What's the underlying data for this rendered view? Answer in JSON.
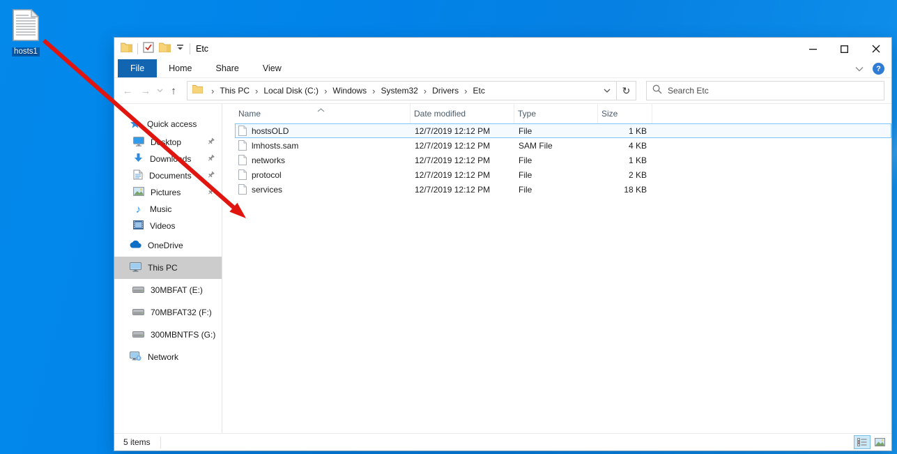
{
  "desktop": {
    "shortcut_label": "hosts1"
  },
  "titlebar": {
    "title": "Etc"
  },
  "ribbon": {
    "tabs": {
      "file": "File",
      "home": "Home",
      "share": "Share",
      "view": "View"
    },
    "help_glyph": "?"
  },
  "nav": {
    "glyphs": {
      "back": "←",
      "forward": "→",
      "up": "↑",
      "refresh": "↻",
      "crumb_sep": "›"
    },
    "breadcrumb": [
      "This PC",
      "Local Disk (C:)",
      "Windows",
      "System32",
      "Drivers",
      "Etc"
    ],
    "search_placeholder": "Search Etc"
  },
  "sidebar": {
    "items": [
      {
        "label": "Quick access"
      },
      {
        "label": "Desktop",
        "pinned": true
      },
      {
        "label": "Downloads",
        "pinned": true
      },
      {
        "label": "Documents",
        "pinned": true
      },
      {
        "label": "Pictures",
        "pinned": true
      },
      {
        "label": "Music"
      },
      {
        "label": "Videos"
      },
      {
        "label": "OneDrive"
      },
      {
        "label": "This PC",
        "selected": true
      },
      {
        "label": "30MBFAT (E:)"
      },
      {
        "label": "70MBFAT32 (F:)"
      },
      {
        "label": "300MBNTFS (G:)"
      },
      {
        "label": "Network"
      }
    ],
    "music_glyph": "♪"
  },
  "filelist": {
    "columns": [
      "Name",
      "Date modified",
      "Type",
      "Size"
    ],
    "rows": [
      {
        "name": "hostsOLD",
        "date": "12/7/2019 12:12 PM",
        "type": "File",
        "size": "1 KB"
      },
      {
        "name": "lmhosts.sam",
        "date": "12/7/2019 12:12 PM",
        "type": "SAM File",
        "size": "4 KB"
      },
      {
        "name": "networks",
        "date": "12/7/2019 12:12 PM",
        "type": "File",
        "size": "1 KB"
      },
      {
        "name": "protocol",
        "date": "12/7/2019 12:12 PM",
        "type": "File",
        "size": "2 KB"
      },
      {
        "name": "services",
        "date": "12/7/2019 12:12 PM",
        "type": "File",
        "size": "18 KB"
      }
    ]
  },
  "statusbar": {
    "count": "5 items"
  },
  "colors": {
    "accent_blue": "#1266b1",
    "desktop_blue": "#0183e9",
    "arrow_red": "#e0150f",
    "selection_border": "#7cc5f8",
    "sidebar_selected_bg": "#cccccc"
  }
}
